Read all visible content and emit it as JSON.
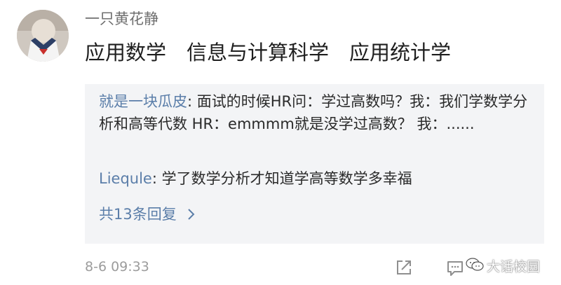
{
  "comment": {
    "username": "一只黄花静",
    "text": "应用数学　信息与计算科学　应用统计学",
    "timestamp": "8-6 09:33"
  },
  "replies": [
    {
      "author": "就是一块瓜皮",
      "separator": ": ",
      "text": "面试的时候HR问：学过高数吗？我：我们学数学分析和高等代数 HR：emmmm就是没学过高数？ 我：......"
    },
    {
      "author": "Liequle",
      "separator": ": ",
      "text": "学了数学分析才知道学高等数学多幸福"
    }
  ],
  "more_replies": {
    "label": "共13条回复",
    "icon": "chevron-right-icon"
  },
  "actions": {
    "icons": [
      "share-icon",
      "comment-icon"
    ]
  },
  "watermark": {
    "text": "大话校园",
    "icon": "wechat-icon"
  },
  "colors": {
    "link": "#5b7ea9",
    "reply_bg": "#f3f4f6",
    "meta": "#9c9c9c"
  }
}
